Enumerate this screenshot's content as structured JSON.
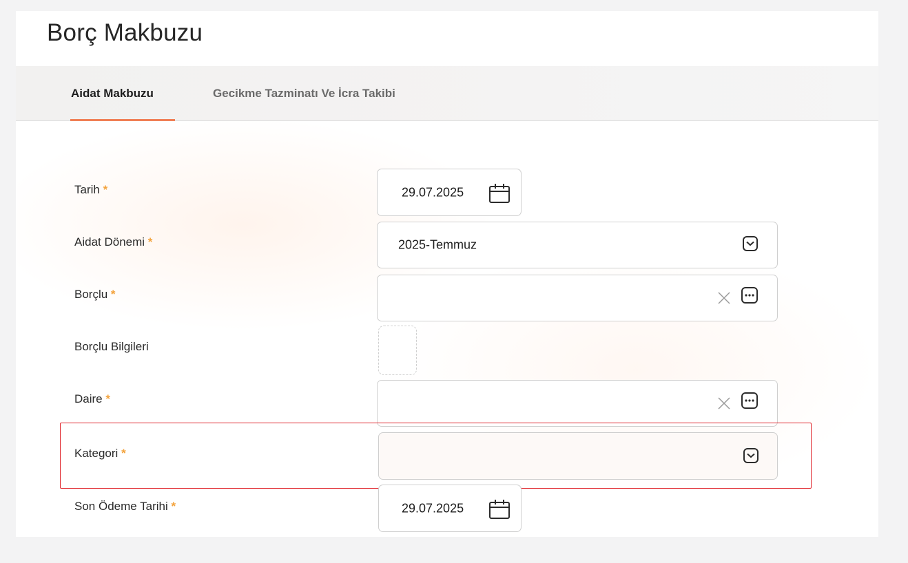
{
  "page": {
    "title": "Borç Makbuzu"
  },
  "tabs": [
    {
      "label": "Aidat Makbuzu",
      "active": true
    },
    {
      "label": "Gecikme Tazminatı Ve İcra Takibi",
      "active": false
    }
  ],
  "form": {
    "required_mark": "*",
    "fields": {
      "tarih": {
        "label": "Tarih",
        "value": "29.07.2025",
        "icon": "calendar-icon"
      },
      "aidat_donemi": {
        "label": "Aidat Dönemi",
        "value": "2025-Temmuz",
        "icon": "chevron-down-icon"
      },
      "borclu": {
        "label": "Borçlu",
        "value": "",
        "icons": [
          "clear-icon",
          "more-options-icon"
        ]
      },
      "borclu_bilgileri": {
        "label": "Borçlu Bilgileri"
      },
      "daire": {
        "label": "Daire",
        "value": "",
        "icons": [
          "clear-icon",
          "more-options-icon"
        ]
      },
      "kategori": {
        "label": "Kategori",
        "value": "",
        "icon": "chevron-down-icon",
        "highlighted": true
      },
      "son_odeme_tarihi": {
        "label": "Son Ödeme Tarihi",
        "value": "29.07.2025",
        "icon": "calendar-icon"
      }
    }
  },
  "colors": {
    "accent": "#f07f55",
    "required": "#f3a33c",
    "highlight_border": "#e0242b"
  }
}
